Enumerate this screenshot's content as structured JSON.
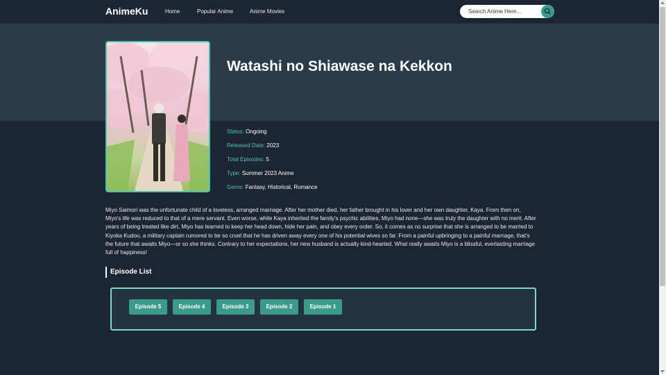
{
  "brand": "AnimeKu",
  "nav": {
    "home": "Home",
    "popular": "Popular Anime",
    "movies": "Anime Movies"
  },
  "search": {
    "placeholder": "Search Anime Here...",
    "icon": "search-icon"
  },
  "anime": {
    "title": "Watashi no Shiawase na Kekkon",
    "poster": "anime-poster",
    "status_label": "Status:",
    "status_value": "Ongoing",
    "released_label": "Released Date:",
    "released_value": "2023",
    "episodes_label": "Total Episodes:",
    "episodes_value": "5",
    "type_label": "Type:",
    "type_value": "Summer 2023 Anime",
    "genre_label": "Genre:",
    "genre_value": "Fantasy, Historical, Romance",
    "synopsis": "Miyo Saimori was the unfortunate child of a loveless, arranged marriage. After her mother died, her father brought in his lover and her own daughter, Kaya. From then on, Miyo's life was reduced to that of a mere servant. Even worse, while Kaya inherited the family's psychic abilities, Miyo had none—she was truly the daughter with no merit. After years of being treated like dirt, Miyo has learned to keep her head down, hide her pain, and obey every order. So, it comes as no surprise that she is arranged to be married to Kiyoka Kudou, a military captain rumored to be so cruel that he has driven away every one of his potential wives so far. From a painful upbringing to a painful marriage, that's the future that awaits Miyo—or so she thinks. Contrary to her expectations, her new husband is actually kind-hearted. What really awaits Miyo is a blissful, everlasting marriage full of happiness!"
  },
  "episode_list": {
    "heading": "Episode List",
    "episodes": [
      "Episode 5",
      "Episode 4",
      "Episode 3",
      "Episode 2",
      "Episode 1"
    ]
  },
  "colors": {
    "background": "#1c2532",
    "hero_band": "#2a3c4a",
    "accent": "#3a9b8b",
    "label": "#4ec3ae"
  }
}
